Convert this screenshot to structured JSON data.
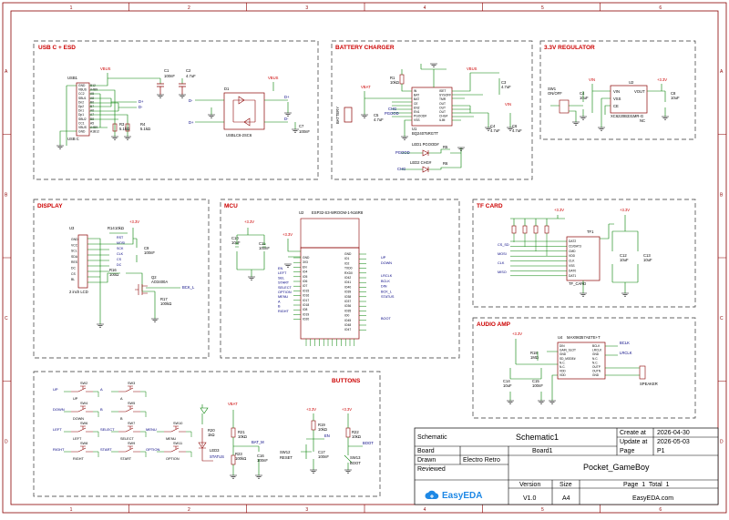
{
  "border": {
    "cols": [
      "1",
      "2",
      "3",
      "4",
      "5",
      "6"
    ],
    "rows": [
      "A",
      "B",
      "C",
      "D"
    ]
  },
  "blocks": {
    "usb": {
      "title": "USB C + ESD"
    },
    "charger": {
      "title": "BATTERY CHARGER"
    },
    "regulator": {
      "title": "3.3V REGULATOR"
    },
    "display": {
      "title": "DISPLAY"
    },
    "mcu": {
      "title": "MCU"
    },
    "tfcard": {
      "title": "TF CARD"
    },
    "audio": {
      "title": "AUDIO AMP"
    },
    "buttons": {
      "title": "BUTTONS"
    }
  },
  "labels": {
    "usb": {
      "usb1": "USB1",
      "vbus": "VBUS",
      "c1": "C1",
      "c1v": "100nF",
      "c2": "C2",
      "c2v": "4.7uF",
      "r3": "R3",
      "r3v": "5.1kΩ",
      "r4": "R4",
      "r4v": "5.1kΩ",
      "dm": "D-",
      "dp": "D+",
      "usbc": "USB C",
      "d1": "D1",
      "d1p": "USBLC6-2SC6",
      "c7": "C7",
      "c7v": "100nF",
      "gnd": "GND",
      "vbus2": "VBUS",
      "pins": [
        "GND",
        "VBUS",
        "CC2",
        "SBU1",
        "Dn2",
        "Dp2",
        "Dn1",
        "Dp1",
        "SBU2",
        "CC1",
        "VBUS",
        "GND"
      ],
      "pinsR": [
        "B12",
        "A4B9",
        "A5",
        "A8",
        "B6",
        "B7",
        "A6",
        "A7",
        "B8",
        "A5",
        "A4B9",
        "A1B12"
      ]
    },
    "charger": {
      "vbat": "VBAT",
      "r1": "R1",
      "r1v": "10kΩ",
      "u1": "U1",
      "u1p": "BQ24075RGTT",
      "c3": "C3",
      "c3v": "4.7uF",
      "c4": "C4",
      "c4v": "4.7uF",
      "c5": "C5",
      "c5v": "4.7uF",
      "c6": "C6",
      "c6v": "4.7uF",
      "bat": "BATTERY",
      "pgood": "PGOOD",
      "chg": "CHG",
      "led1": "LED1 PGOOD#",
      "led2": "LED2 CHG#",
      "r5": "R5",
      "r6": "R6",
      "vin": "VIN",
      "pinsL": [
        "IN",
        "BAT",
        "BAT",
        "CE",
        "EN2",
        "EN1",
        "PGOOD#",
        "VSS"
      ],
      "pinsR": [
        "ISET",
        "SYSOFF",
        "TMR",
        "OUT",
        "OUT",
        "OUT",
        "CHG#",
        "ILIM"
      ]
    },
    "regulator": {
      "vin": "VIN",
      "sw1": "SW1",
      "sw1v": "ON/OFF",
      "c4": "C4",
      "c4v": "10uF",
      "u2": "U2",
      "u2p": "XC6220B331MR-G",
      "c8": "C8",
      "c8v": "10uF",
      "v33": "+3.3V",
      "vout": "VOUT",
      "nc": "NC",
      "vin2": "VIN",
      "vss": "VSS",
      "ce": "CE"
    },
    "display": {
      "u3": "U3",
      "lcd": "2 inch LCD",
      "r14": "R14",
      "r14v": "10kΩ",
      "c9": "C9",
      "c9v": "100nF",
      "q2": "Q2",
      "q2p": "AO3400A",
      "r16": "R16",
      "r16v": "100Ω",
      "r17": "R17",
      "r17v": "100kΩ",
      "bckl": "BCK_L",
      "v33": "+3.3V",
      "pins": [
        "GND",
        "VCC",
        "SCL",
        "SDA",
        "RES",
        "DC",
        "CS",
        "BL"
      ],
      "nets": [
        "RST",
        "MOSI",
        "SCK",
        "CLK",
        "CS",
        "DC"
      ]
    },
    "mcu": {
      "u2": "U2",
      "u2p": "ESP32-S3-WROOM-1-N16R8",
      "c10": "C10",
      "c10v": "10uF",
      "c11": "C11",
      "c11v": "100nF",
      "v33": "+3.3V",
      "netsL": [
        "EN",
        "LEFT",
        "SEL",
        "START",
        "SELECT",
        "OPTION",
        "MENU",
        "A",
        "B",
        "RIGHT"
      ],
      "netsR": [
        "UP",
        "DOWN",
        "LRCLK",
        "BCLK",
        "DIN",
        "BCK_L",
        "STATUS",
        "BOOT"
      ],
      "pinsL": [
        "GND",
        "3V3",
        "EN",
        "IO4",
        "IO5",
        "IO6",
        "IO7",
        "IO15",
        "IO16",
        "IO17",
        "IO18",
        "IO8",
        "IO19",
        "IO20"
      ],
      "pinsR": [
        "GND",
        "IO1",
        "IO2",
        "TXD0",
        "RXD0",
        "IO42",
        "IO41",
        "IO40",
        "IO39",
        "IO38",
        "IO37",
        "IO36",
        "IO35",
        "IO0",
        "IO45",
        "IO48",
        "IO47"
      ]
    },
    "tfcard": {
      "tf1": "TF1",
      "tfp": "TF_CARD",
      "v33": "+3.3V",
      "nets": [
        "CS_SD",
        "MOSI",
        "CLK",
        "MISO"
      ],
      "pins": [
        "DAT2",
        "CD/DAT3",
        "CMD",
        "VDD",
        "CLK",
        "VSS",
        "DAT0",
        "DAT1"
      ],
      "c12": "C12",
      "c12v": "10uF",
      "c13": "C13",
      "c13v": "10uF"
    },
    "audio": {
      "u4": "U4",
      "u4p": "MAX98357AETE+T",
      "v33": "+3.3V",
      "r18": "R18",
      "r18v": "1MΩ",
      "c14": "C14",
      "c14v": "10uF",
      "c15": "C15",
      "c15v": "100nF",
      "bclk": "BCLK",
      "lrclk": "LRCLK",
      "spk": "SPEAKER",
      "pinsL": [
        "DIN",
        "GAIN_SLOT",
        "GND",
        "SD_MODE#",
        "N.C.",
        "N.C.",
        "VDD",
        "VDD"
      ],
      "pinsR": [
        "BCLK",
        "LRCLK",
        "GND",
        "N.C.",
        "N.C.",
        "OUTP",
        "OUTN",
        "GND"
      ]
    },
    "buttons": {
      "dpad": [
        "UP",
        "DOWN",
        "LEFT",
        "RIGHT"
      ],
      "dsw": [
        "SW2",
        "SW4",
        "SW6",
        "SW8"
      ],
      "mid": [
        "A",
        "B",
        "SELECT",
        "START"
      ],
      "msw": [
        "SW3",
        "SW5",
        "SW7",
        "SW9"
      ],
      "menu": [
        "MENU",
        "OPTION"
      ],
      "menusw": [
        "SW10",
        "SW11"
      ],
      "led3": "LED3",
      "led3s": "STATUS",
      "r20": "R20",
      "r20v": "1kΩ",
      "r21": "R21",
      "r21v": "10kΩ",
      "r23": "R23",
      "r23v": "100kΩ",
      "c16": "C16",
      "c16v": "100nF",
      "vbat": "VBAT",
      "batm": "BAT_M",
      "r19": "R19",
      "r19v": "10kΩ",
      "c17": "C17",
      "c17v": "100nF",
      "sw12": "SW12",
      "reset": "RESET",
      "en": "EN",
      "r22": "R22",
      "r22v": "10kΩ",
      "sw13": "SW13",
      "boot": "BOOT",
      "v33": "+3.3V"
    }
  },
  "titleblock": {
    "schematic_label": "Schematic",
    "schematic_value": "Schematic1",
    "created_label": "Create at",
    "created_value": "2026-04-30",
    "update_label": "Update at",
    "update_value": "2026-05-03",
    "board_label": "Board",
    "board_value": "Board1",
    "page_label": "Page",
    "page_value": "P1",
    "drawn_label": "Drawn",
    "drawn_value": "Electro Retro",
    "reviewed_label": "Reviewed",
    "project_title": "Pocket_GameBoy",
    "version_label": "Version",
    "version_value": "V1.0",
    "size_label": "Size",
    "size_value": "A4",
    "page_total": "Page  1  Total  1",
    "brand": "EasyEDA",
    "site": "EasyEDA.com"
  },
  "colors": {
    "border": "#8b0000",
    "wire": "#008000",
    "component": "#8b0000",
    "net": "#000080",
    "title": "#cc0000",
    "power": "#cc0000",
    "brand": "#1e88e5"
  }
}
